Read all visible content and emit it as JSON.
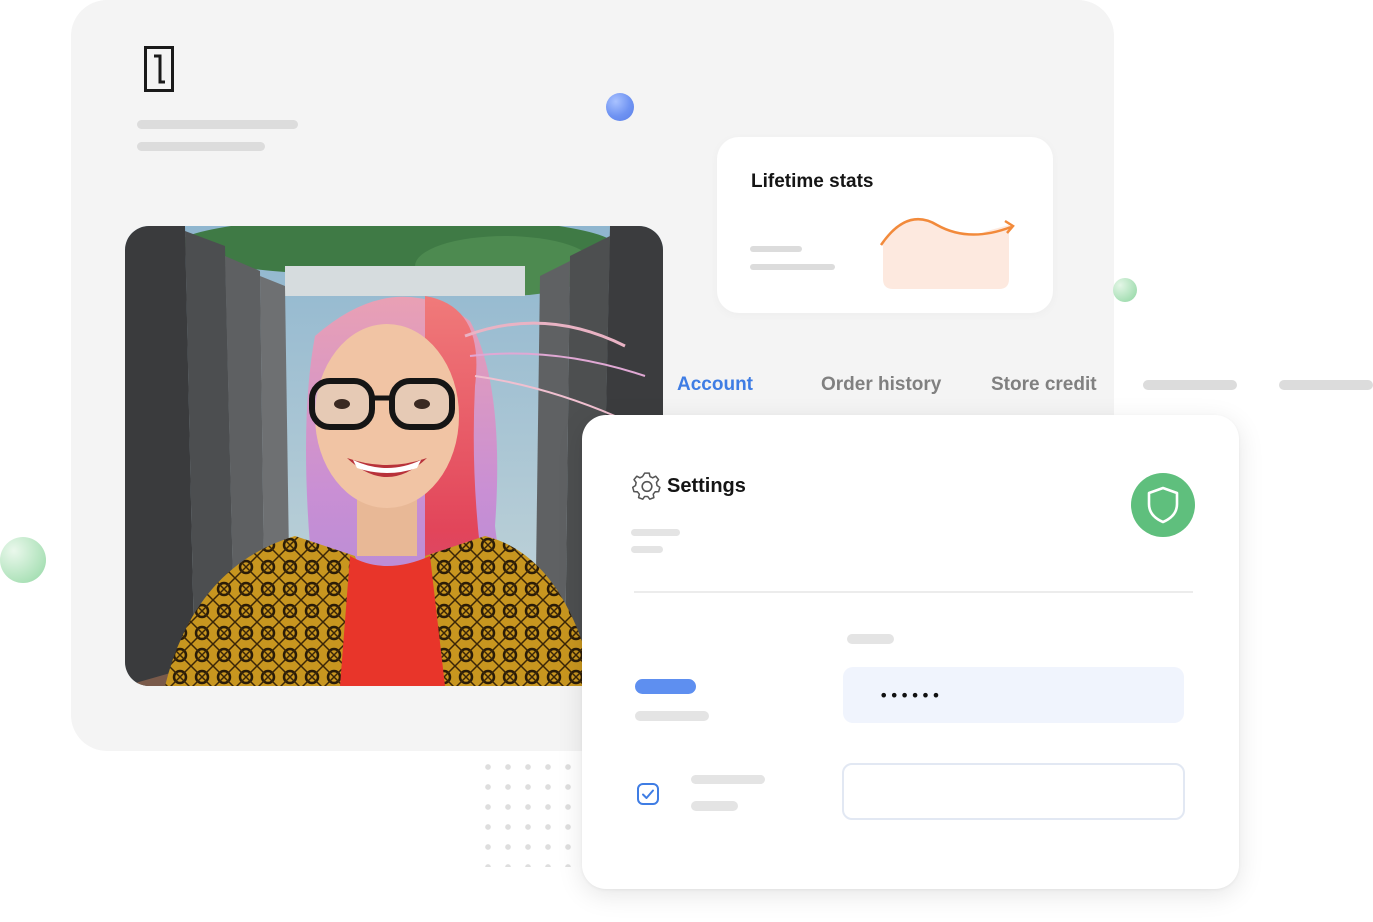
{
  "stats_card": {
    "title": "Lifetime stats"
  },
  "tabs": [
    {
      "label": "Account",
      "active": true
    },
    {
      "label": "Order history",
      "active": false
    },
    {
      "label": "Store credit",
      "active": false
    }
  ],
  "settings": {
    "title": "Settings",
    "password_value": "••••••",
    "checkbox_checked": true
  },
  "icons": [
    "brand-logo-icon",
    "gear-icon",
    "shield-icon",
    "checkbox-icon",
    "trend-chart-icon"
  ],
  "colors": {
    "accent": "#3f7de4",
    "shield": "#5fbf7d",
    "chart_line": "#f28a3b",
    "chart_fill": "#fde9df",
    "panel": "#f4f4f4"
  }
}
